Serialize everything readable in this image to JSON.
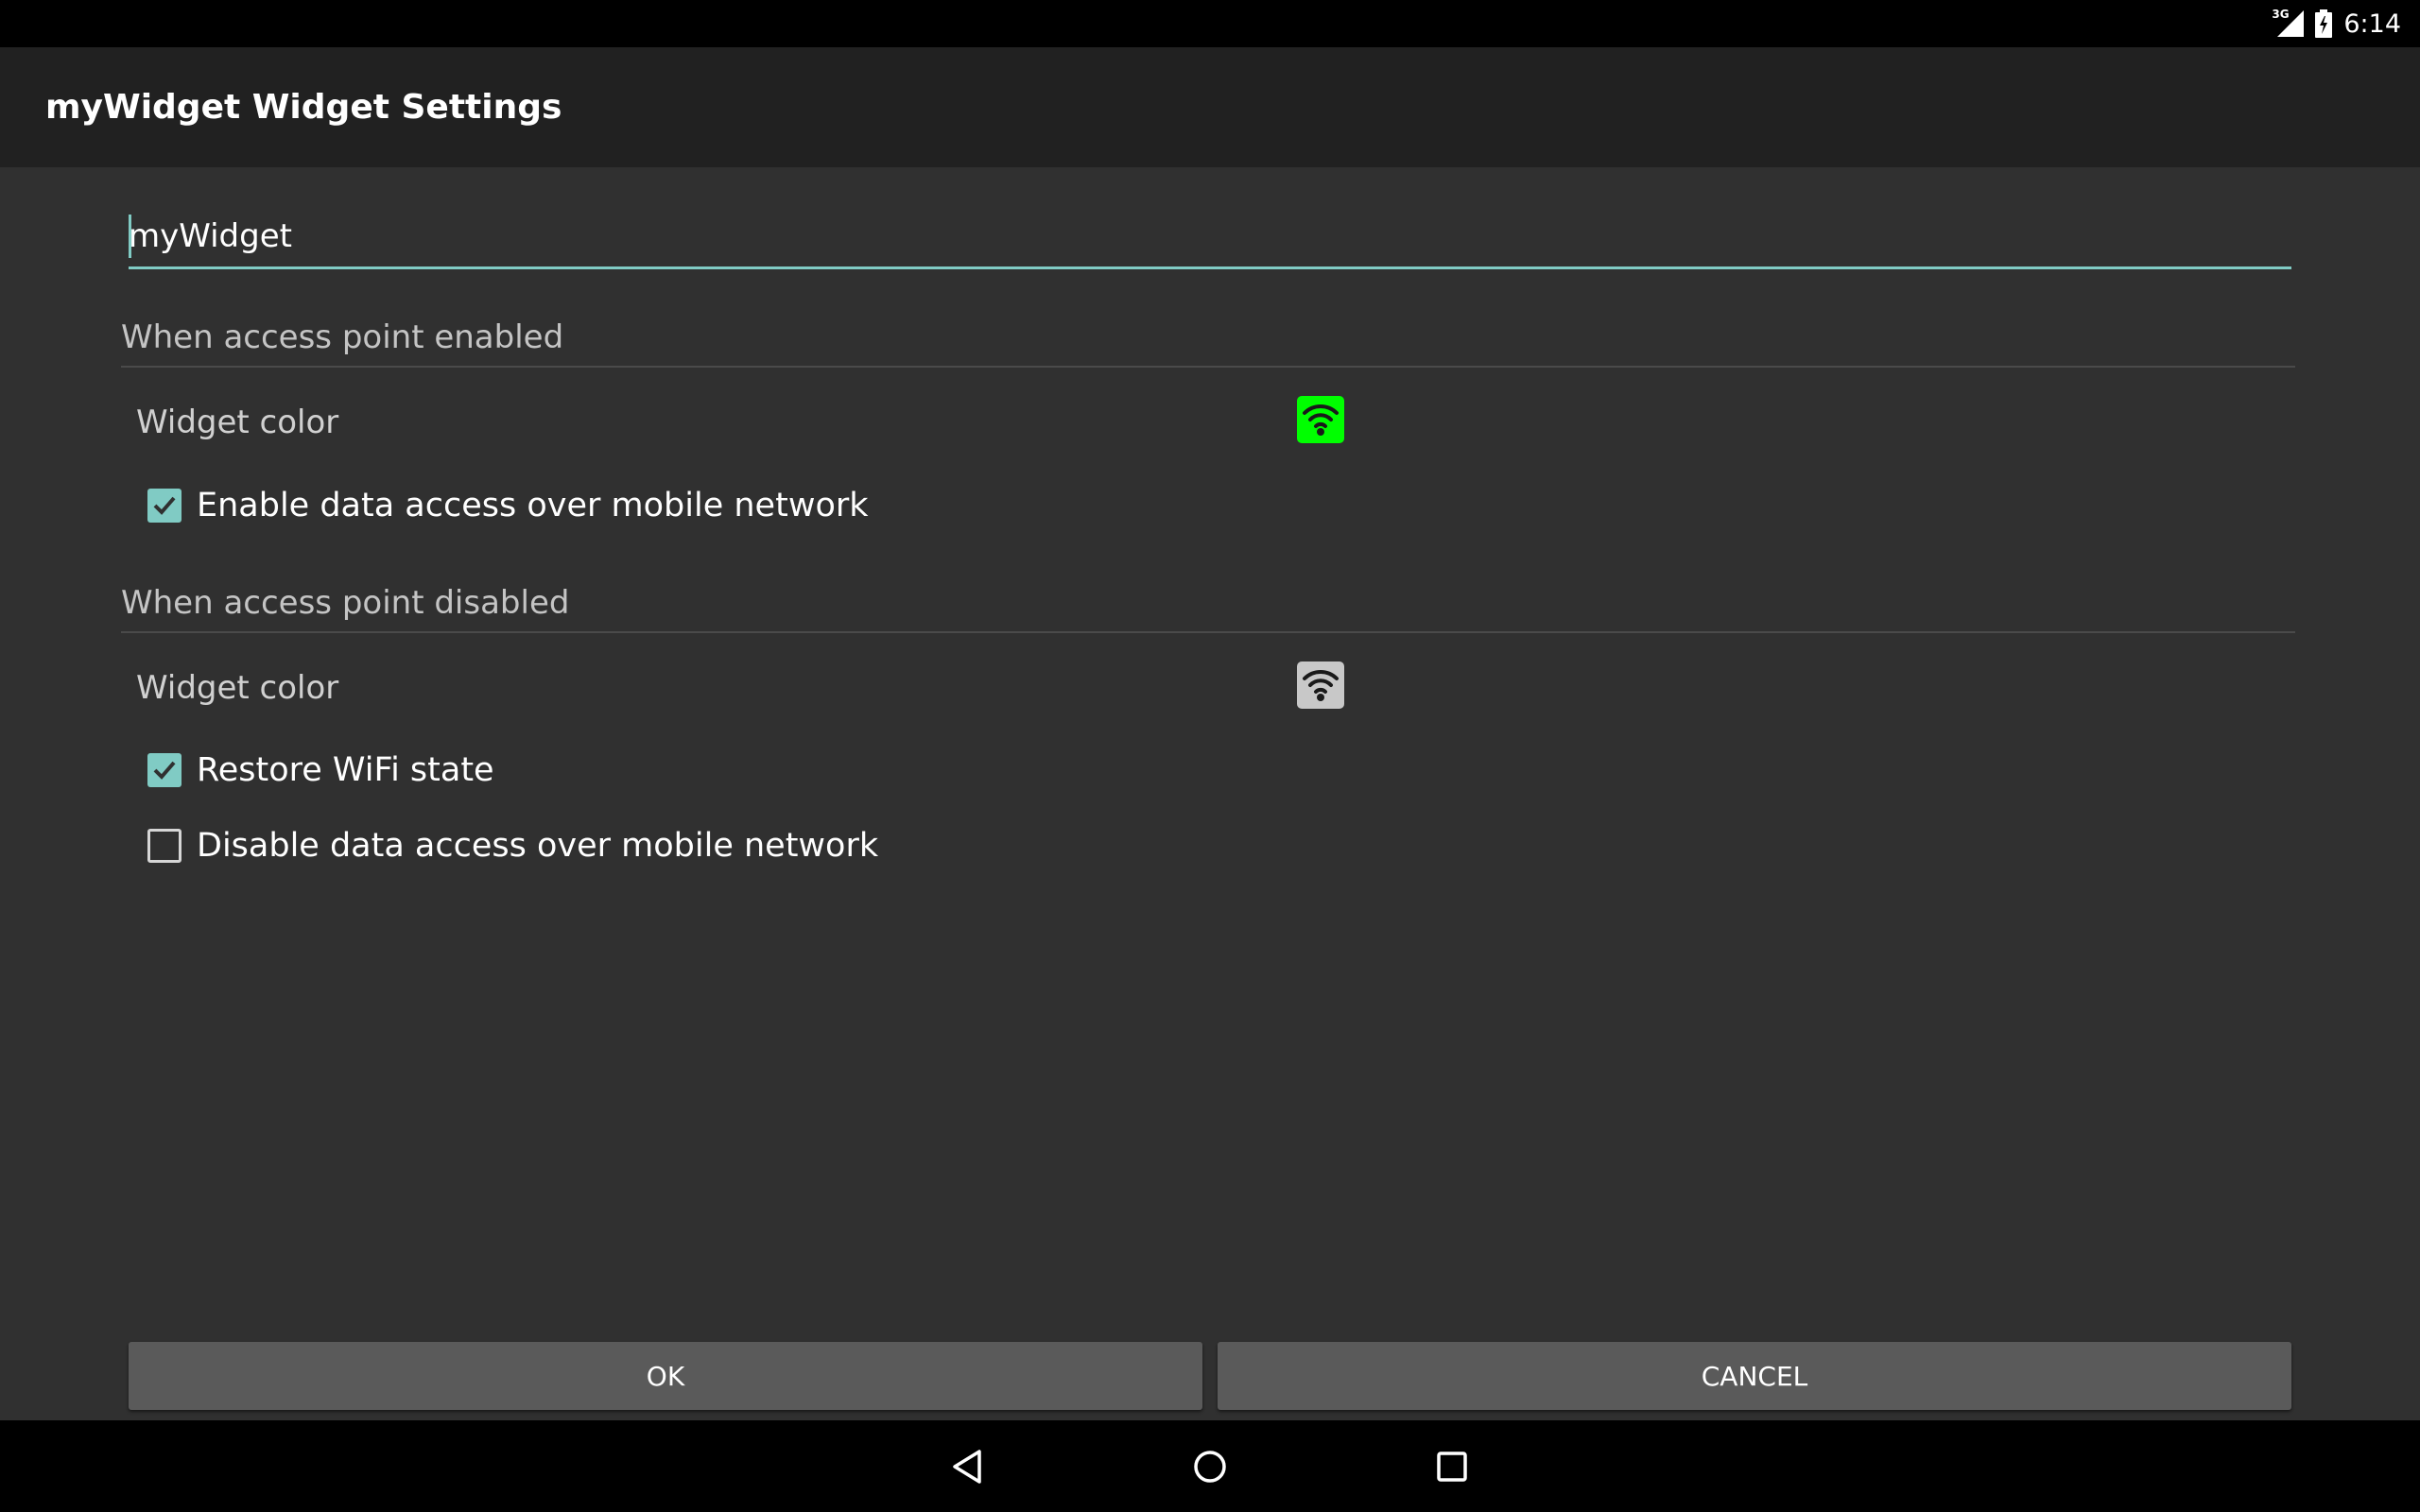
{
  "status_bar": {
    "network_type": "3G",
    "time": "6:14",
    "icons": [
      "signal-icon",
      "battery-charging-icon"
    ]
  },
  "action_bar": {
    "title": "myWidget Widget Settings"
  },
  "name_field": {
    "value": "myWidget"
  },
  "enabled_section": {
    "header": "When access point enabled",
    "widget_color_label": "Widget color",
    "widget_color": "#00ff00",
    "widget_icon": "wifi-icon",
    "checkbox_label": "Enable data access over mobile network",
    "checkbox_checked": true
  },
  "disabled_section": {
    "header": "When access point disabled",
    "widget_color_label": "Widget color",
    "widget_color": "#c8c8c8",
    "widget_icon": "wifi-icon",
    "restore_wifi_label": "Restore WiFi state",
    "restore_wifi_checked": true,
    "disable_data_label": "Disable data access over mobile network",
    "disable_data_checked": false
  },
  "buttons": {
    "ok": "OK",
    "cancel": "CANCEL"
  },
  "nav_bar": {
    "icons": [
      "back-icon",
      "home-icon",
      "recents-icon"
    ]
  },
  "colors": {
    "accent": "#80cbc4",
    "background": "#303030",
    "action_bar": "#212121",
    "button": "#5a5a5a"
  }
}
